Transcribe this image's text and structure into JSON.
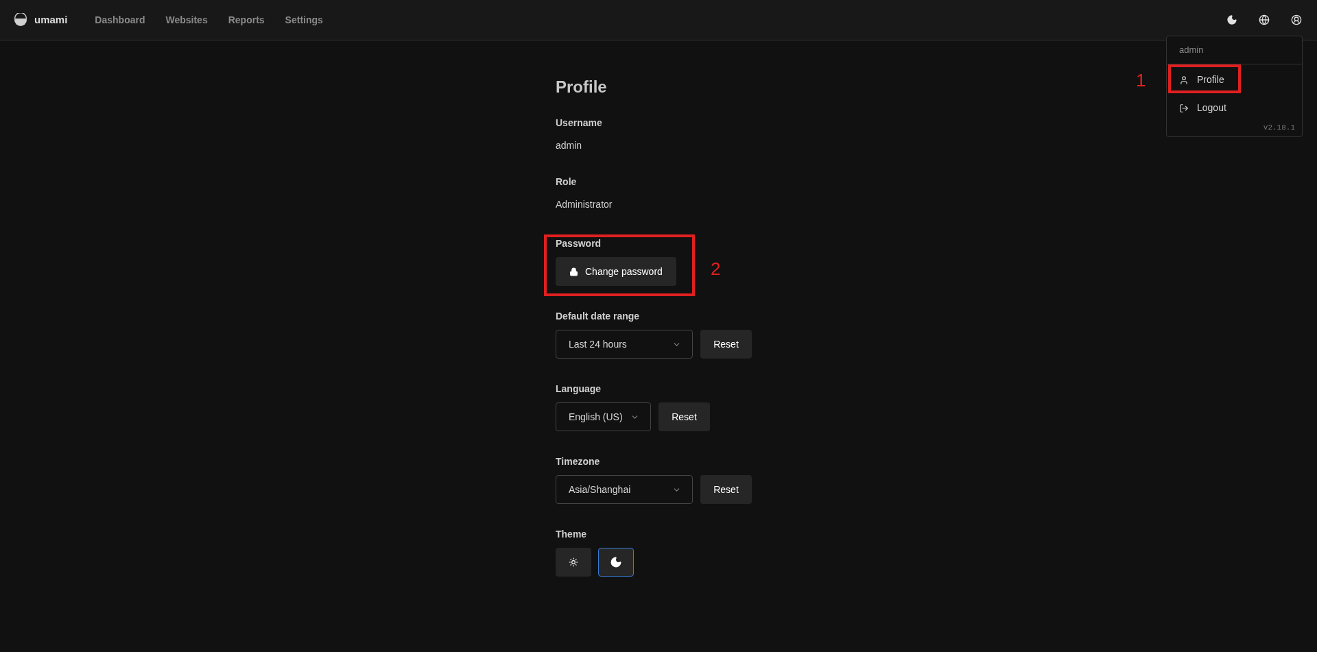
{
  "header": {
    "brand": "umami",
    "nav": [
      {
        "label": "Dashboard",
        "selected": false
      },
      {
        "label": "Websites",
        "selected": false
      },
      {
        "label": "Reports",
        "selected": false
      },
      {
        "label": "Settings",
        "selected": false
      }
    ]
  },
  "user_menu": {
    "username": "admin",
    "items": [
      {
        "kind": "profile",
        "label": "Profile"
      },
      {
        "kind": "logout",
        "label": "Logout"
      }
    ],
    "version": "v2.18.1"
  },
  "profile": {
    "title": "Profile",
    "info": [
      {
        "label": "Username",
        "value": "admin"
      },
      {
        "label": "Role",
        "value": "Administrator"
      }
    ],
    "password": {
      "label": "Password",
      "button": "Change password"
    },
    "selects": [
      {
        "label": "Default date range",
        "value": "Last 24 hours",
        "wide": true,
        "reset": "Reset"
      },
      {
        "label": "Language",
        "value": "English (US)",
        "wide": false,
        "reset": "Reset"
      },
      {
        "label": "Timezone",
        "value": "Asia/Shanghai",
        "wide": true,
        "reset": "Reset"
      }
    ],
    "theme": {
      "label": "Theme",
      "options": [
        {
          "kind": "light",
          "selected": false
        },
        {
          "kind": "dark",
          "selected": true
        }
      ]
    }
  },
  "annotations": [
    {
      "number": "1"
    },
    {
      "number": "2"
    }
  ]
}
